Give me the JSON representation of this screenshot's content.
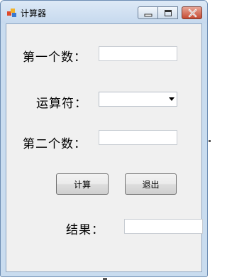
{
  "window": {
    "title": "计算器",
    "icons": {
      "app": "app-colored-blocks-icon",
      "minimize": "minimize-icon",
      "maximize": "maximize-icon",
      "close": "close-icon"
    }
  },
  "form": {
    "first_number_label": "第一个数：",
    "first_number_value": "",
    "operator_label": "运算符：",
    "operator_value": "",
    "second_number_label": "第二个数：",
    "second_number_value": "",
    "calculate_button": "计算",
    "exit_button": "退出",
    "result_label": "结果：",
    "result_value": ""
  },
  "colors": {
    "close_button": "#c54a32",
    "title_bar": "#c9dcef",
    "client_bg": "#f0f0f0"
  }
}
